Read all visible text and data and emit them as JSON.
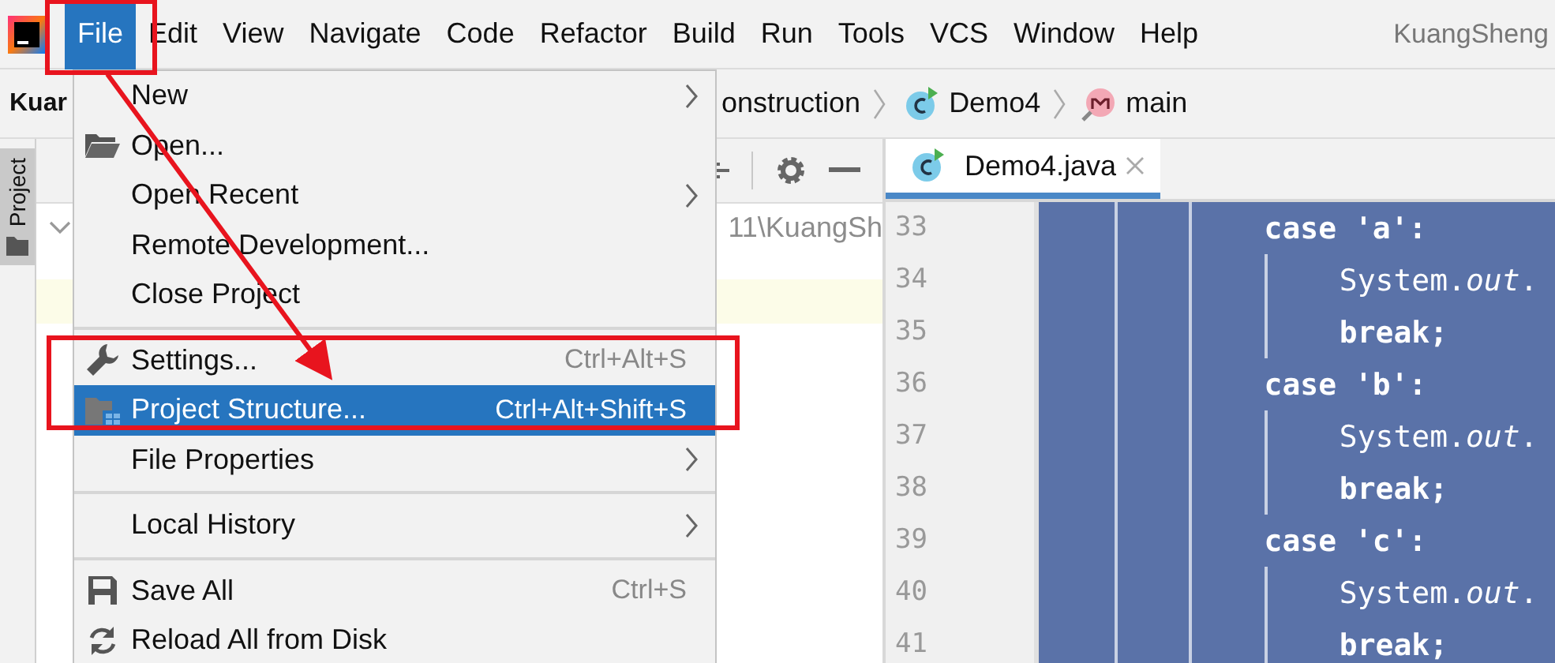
{
  "menu_bar": {
    "items": [
      {
        "label": "File",
        "selected": true
      },
      {
        "label": "Edit",
        "selected": false
      },
      {
        "label": "View",
        "selected": false
      },
      {
        "label": "Navigate",
        "selected": false
      },
      {
        "label": "Code",
        "selected": false
      },
      {
        "label": "Refactor",
        "selected": false
      },
      {
        "label": "Build",
        "selected": false
      },
      {
        "label": "Run",
        "selected": false
      },
      {
        "label": "Tools",
        "selected": false
      },
      {
        "label": "VCS",
        "selected": false
      },
      {
        "label": "Window",
        "selected": false
      },
      {
        "label": "Help",
        "selected": false
      }
    ],
    "project_name": "KuangSheng"
  },
  "breadcrumb": {
    "items": [
      {
        "label": "Kuar",
        "kind": "project"
      },
      {
        "label": "onstruction",
        "kind": "folder"
      },
      {
        "label": "Demo4",
        "kind": "class"
      },
      {
        "label": "main",
        "kind": "method"
      }
    ]
  },
  "tool_window": {
    "tab": "Project",
    "path": "11\\KuangSh"
  },
  "editor": {
    "tabs": [
      {
        "label": "Demo4.java",
        "selected": true
      }
    ],
    "lines": [
      {
        "number": "33",
        "kind": "case",
        "code": "case 'a':"
      },
      {
        "number": "34",
        "kind": "statement",
        "code": "System.*out*."
      },
      {
        "number": "35",
        "kind": "statement",
        "code": "break;"
      },
      {
        "number": "36",
        "kind": "case",
        "code": "case 'b':"
      },
      {
        "number": "37",
        "kind": "statement",
        "code": "System.*out*."
      },
      {
        "number": "38",
        "kind": "statement",
        "code": "break;"
      },
      {
        "number": "39",
        "kind": "case",
        "code": "case 'c':"
      },
      {
        "number": "40",
        "kind": "statement",
        "code": "System.*out*."
      },
      {
        "number": "41",
        "kind": "statement",
        "code": "break;"
      }
    ]
  },
  "file_menu": {
    "items": [
      {
        "kind": "plain",
        "label": "New",
        "submenu": true,
        "selected": false
      },
      {
        "kind": "open",
        "label": "Open...",
        "submenu": false,
        "selected": false
      },
      {
        "kind": "plain",
        "label": "Open Recent",
        "submenu": true,
        "selected": false
      },
      {
        "kind": "plain",
        "label": "Remote Development...",
        "submenu": false,
        "selected": false
      },
      {
        "kind": "plain",
        "label": "Close Project",
        "submenu": false,
        "selected": false
      },
      {
        "kind": "separator"
      },
      {
        "kind": "settings",
        "label": "Settings...",
        "shortcut": "Ctrl+Alt+S",
        "submenu": false,
        "selected": false
      },
      {
        "kind": "structure",
        "label": "Project Structure...",
        "shortcut": "Ctrl+Alt+Shift+S",
        "submenu": false,
        "selected": true
      },
      {
        "kind": "plain",
        "label": "File Properties",
        "submenu": true,
        "selected": false
      },
      {
        "kind": "separator"
      },
      {
        "kind": "plain",
        "label": "Local History",
        "submenu": true,
        "selected": false
      },
      {
        "kind": "separator"
      },
      {
        "kind": "save",
        "label": "Save All",
        "shortcut": "Ctrl+S",
        "submenu": false,
        "selected": false
      },
      {
        "kind": "reload",
        "label": "Reload All from Disk",
        "submenu": false,
        "selected": false
      }
    ]
  }
}
